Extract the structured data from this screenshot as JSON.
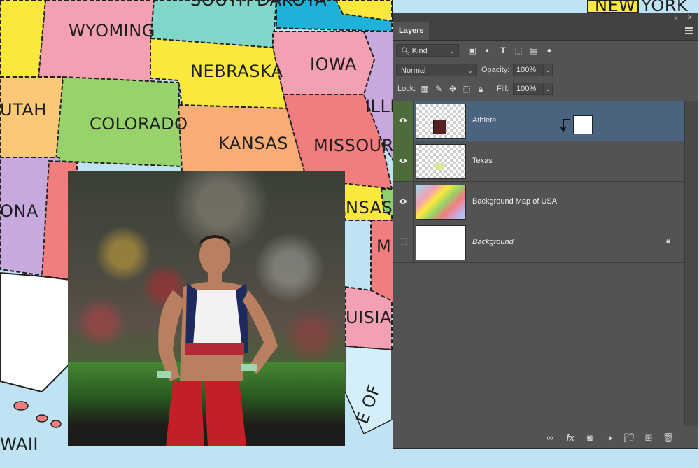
{
  "map": {
    "states": [
      "WYOMING",
      "SOUTH DAKOTA",
      "IOWA",
      "NEBRASKA",
      "UTAH",
      "COLORADO",
      "KANSAS",
      "MISSOURI",
      "ILLIN",
      "ONA",
      "NSAS",
      "MI SS",
      "UISIANA",
      "NEW YORK",
      "WAII",
      "E OF"
    ],
    "colors": {
      "wyoming": "#f3a0b2",
      "south_dakota": "#7fd6c9",
      "iowa": "#f3a0b2",
      "nebraska": "#fbe83c",
      "utah": "#fbc878",
      "colorado": "#98d26a",
      "kansas": "#f9ad76",
      "missouri": "#f27d7f",
      "illinois": "#c7a9dd",
      "arizona": "#c7a9dd",
      "ocean": "#bfe3f2"
    }
  },
  "panel": {
    "tab": "Layers",
    "filter": {
      "kind_label": "Kind"
    },
    "blend": {
      "mode": "Normal",
      "opacity_label": "Opacity:",
      "opacity_value": "100%"
    },
    "lock": {
      "label": "Lock:",
      "fill_label": "Fill:",
      "fill_value": "100%"
    },
    "layers": [
      {
        "name": "Athlete",
        "visible": true,
        "selected": true,
        "clipped_mask": true
      },
      {
        "name": "Texas",
        "visible": true,
        "selected": false
      },
      {
        "name": "Background Map of USA",
        "visible": true,
        "selected": false
      },
      {
        "name": "Background",
        "visible": false,
        "selected": false,
        "locked": true
      }
    ],
    "accent": "#4a637f"
  }
}
